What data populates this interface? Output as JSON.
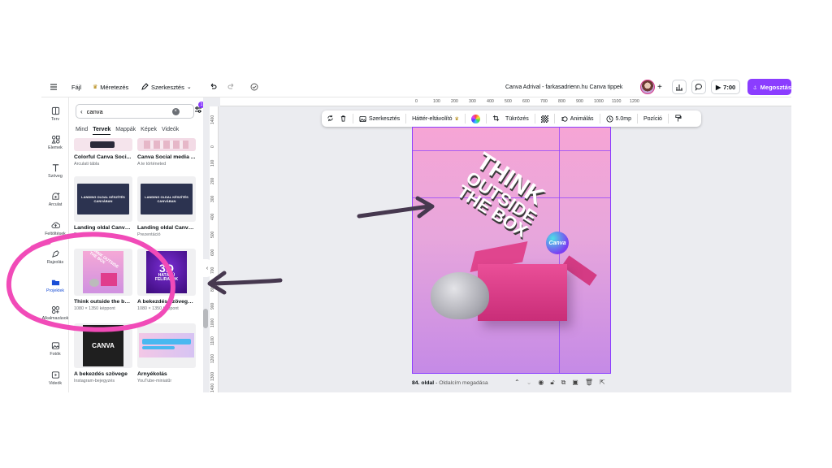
{
  "topbar": {
    "file": "Fájl",
    "resize": "Méretezés",
    "edit": "Szerkesztés",
    "doc_title": "Canva Adrival - farkasadrienn.hu Canva tippek",
    "timer": "7:00",
    "share": "Megosztás"
  },
  "rail": [
    {
      "label": "Terv",
      "icon": "layout-icon"
    },
    {
      "label": "Elemek",
      "icon": "shapes-icon"
    },
    {
      "label": "Szöveg",
      "icon": "text-icon"
    },
    {
      "label": "Arculat",
      "icon": "brand-icon"
    },
    {
      "label": "Feltöltések",
      "icon": "upload-icon"
    },
    {
      "label": "Rajzolás",
      "icon": "draw-icon"
    },
    {
      "label": "Projektek",
      "icon": "folder-icon"
    },
    {
      "label": "Alkalmazások",
      "icon": "apps-icon"
    },
    {
      "label": "Fotók",
      "icon": "photo-icon"
    },
    {
      "label": "Videók",
      "icon": "video-icon"
    }
  ],
  "search": {
    "value": "canva",
    "filter_badge": "1"
  },
  "tabs": [
    "Mind",
    "Tervek",
    "Mappák",
    "Képek",
    "Videók"
  ],
  "active_tab": "Tervek",
  "cards": [
    {
      "title": "Colorful Canva Soci...",
      "sub": "Arculati tábla"
    },
    {
      "title": "Canva Social media ...",
      "sub": "A te történeted"
    },
    {
      "title": "Landing oldal Canvá...",
      "sub": "Prezentáció"
    },
    {
      "title": "Landing oldal Canvá...",
      "sub": "Prezentáció"
    },
    {
      "title": "Think outside the bo...",
      "sub": "1080 × 1350 képpont"
    },
    {
      "title": "A bekezdés szövege ...",
      "sub": "1080 × 1350 képpont"
    },
    {
      "title": "A bekezdés szövege",
      "sub": "Instagram-bejegyzés"
    },
    {
      "title": "Árnyékolás",
      "sub": "YouTube-miniatűr"
    }
  ],
  "thumb_text": {
    "landing": "LANDING OLDAL KÉSZÍTÉS CANVÁBAN",
    "think": "THINK OUTSIDE THE BOX",
    "three_d": "3D",
    "hatasu": "HATÁSÚ",
    "feliratok": "FELIRATOK",
    "canva": "CANVA"
  },
  "ruler_top": [
    "0",
    "100",
    "200",
    "300",
    "400",
    "500",
    "600",
    "700",
    "800",
    "900",
    "1000",
    "1100",
    "1200"
  ],
  "ruler_left": [
    "1400",
    "0",
    "100",
    "200",
    "300",
    "400",
    "500",
    "600",
    "700",
    "800",
    "900",
    "1000",
    "1100",
    "1200",
    "1300",
    "1400"
  ],
  "toolbar": {
    "edit": "Szerkesztés",
    "bg_remover": "Háttér-eltávolító",
    "flip": "Tükrözés",
    "animate": "Animálás",
    "duration": "5.0mp",
    "position": "Pozíció"
  },
  "canvas": {
    "line1": "THINK",
    "line2": "OUTSIDE",
    "line3": "THE BOX",
    "badge": "Canva"
  },
  "bottom": {
    "page": "84. oldal",
    "page_title": "Oldalcím megadása"
  },
  "colors": {
    "accent": "#8b3dff",
    "annotation": "#f14bb8",
    "arrow": "#46384f"
  }
}
